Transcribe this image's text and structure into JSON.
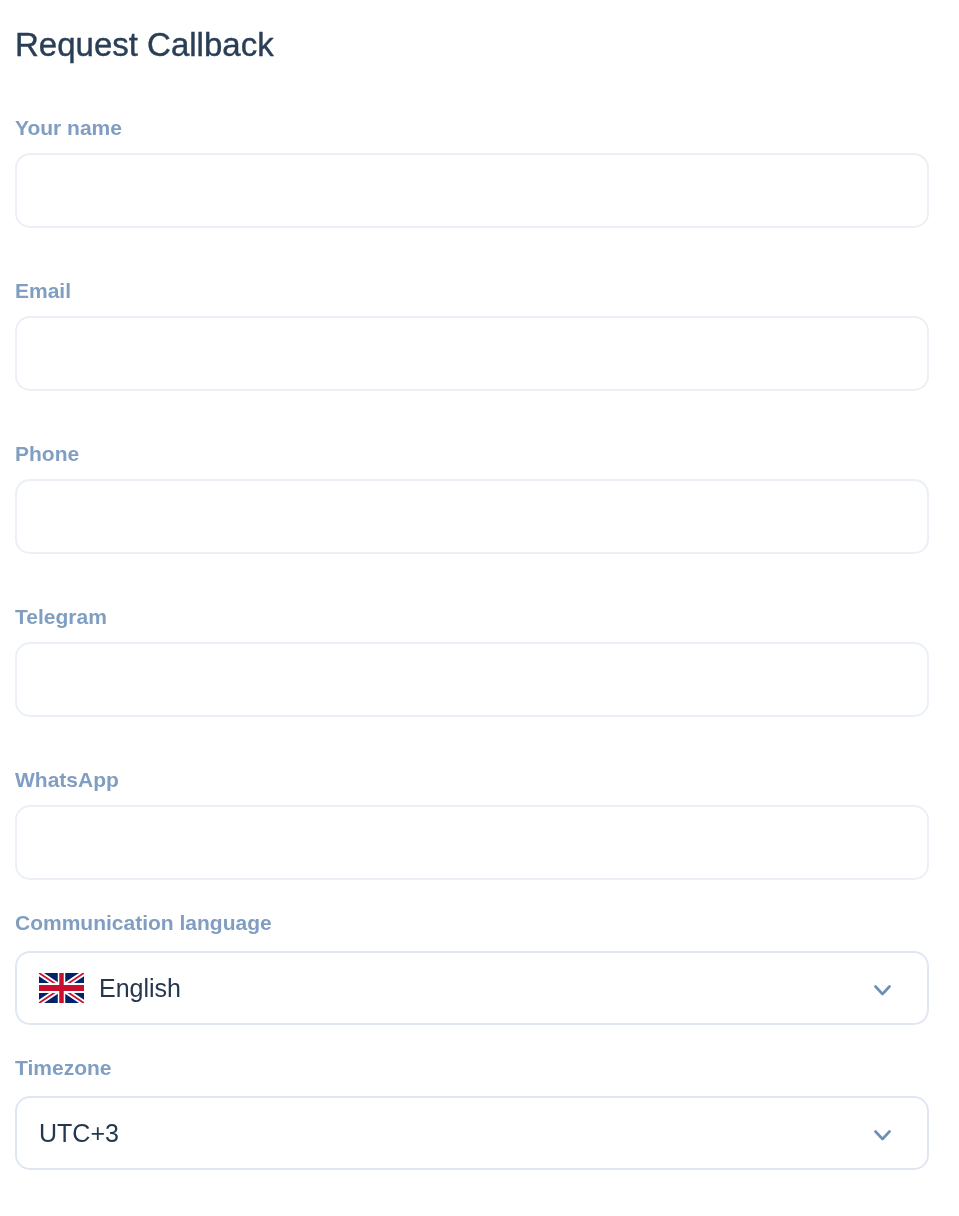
{
  "title": "Request Callback",
  "fields": [
    {
      "kind": "text",
      "label": "Your name"
    },
    {
      "kind": "text",
      "label": "Email"
    },
    {
      "kind": "text",
      "label": "Phone"
    },
    {
      "kind": "text",
      "label": "Telegram"
    },
    {
      "kind": "text",
      "label": "WhatsApp"
    },
    {
      "kind": "language",
      "label": "Communication language",
      "value": "English"
    },
    {
      "kind": "select",
      "label": "Timezone",
      "value": "UTC+3"
    }
  ]
}
